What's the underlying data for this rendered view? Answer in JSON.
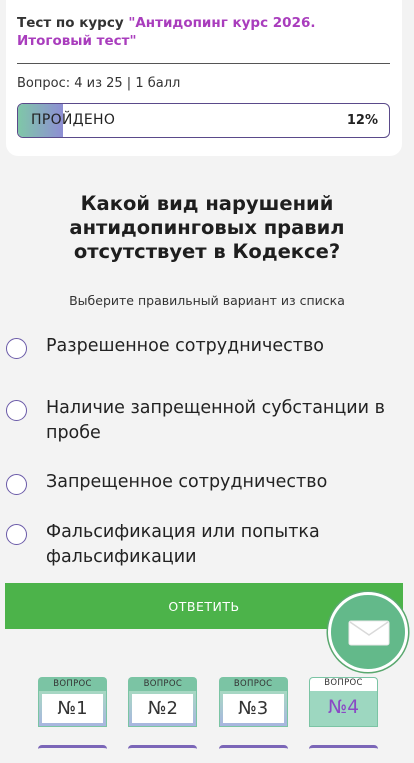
{
  "header": {
    "title_prefix": "Тест по курсу",
    "course_name": "\"Антидопинг курс 2026. Итоговый тест\"",
    "question_info": "Вопрос: 4 из 25 | 1 балл",
    "progress": {
      "label": "ПРОЙДЕНО",
      "percent_text": "12%",
      "percent": 12
    }
  },
  "question": {
    "text": "Какой вид нарушений антидопинговых правил отсутствует в Кодексе?",
    "hint": "Выберите правильный вариант из списка"
  },
  "options": [
    {
      "label": "Разрешенное сотрудничество"
    },
    {
      "label": "Наличие запрещенной субстанции в пробе"
    },
    {
      "label": "Запрещенное сотрудничество"
    },
    {
      "label": "Фальсификация или попытка фальсификации"
    }
  ],
  "answer_button": {
    "label": "ОТВЕТИТЬ"
  },
  "feedback_button": {
    "icon": "mail-icon"
  },
  "question_nav": {
    "caption": "ВОПРОС",
    "items": [
      {
        "label": "№1",
        "active": false
      },
      {
        "label": "№2",
        "active": false
      },
      {
        "label": "№3",
        "active": false
      },
      {
        "label": "№4",
        "active": true
      }
    ]
  },
  "colors": {
    "accent_green": "#4cb34a",
    "course_purple": "#a93dbd",
    "radio_border": "#6a5aa8",
    "active_number": "#8a49c5"
  }
}
